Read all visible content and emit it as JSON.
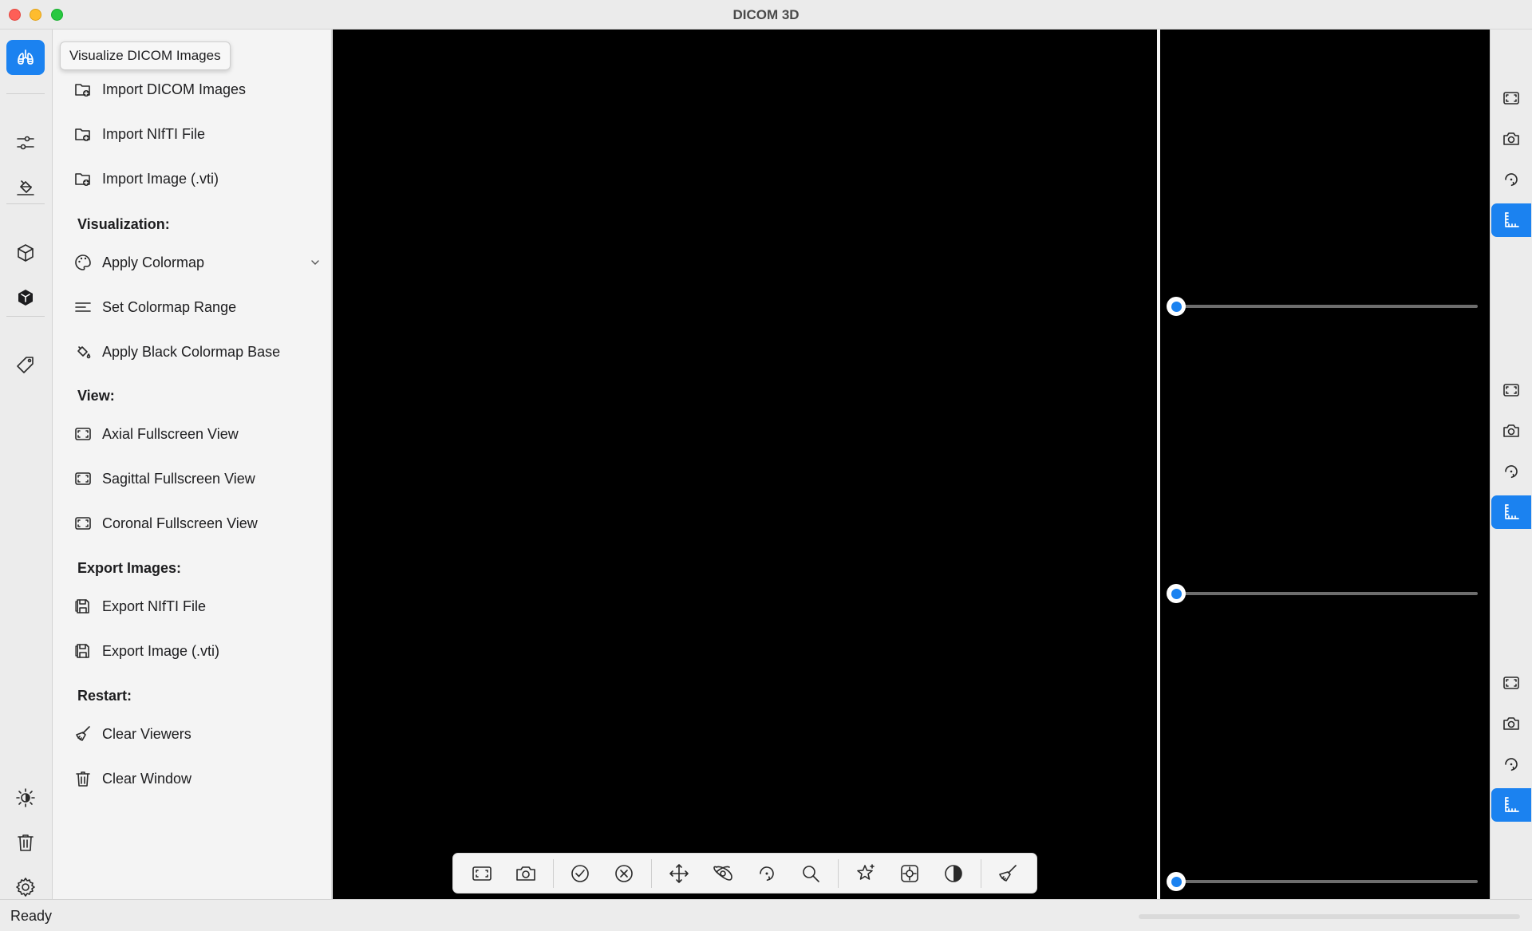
{
  "window": {
    "title": "DICOM 3D"
  },
  "tooltip": {
    "text": "Visualize DICOM Images"
  },
  "rail": {
    "items": [
      {
        "icon": "lungs-icon",
        "active": true
      },
      {
        "icon": "sliders-icon"
      },
      {
        "icon": "paint-bucket-icon"
      },
      {
        "icon": "cube-outline-icon"
      },
      {
        "icon": "cube-solid-icon"
      },
      {
        "icon": "tag-icon"
      },
      {
        "icon": "brightness-icon"
      },
      {
        "icon": "trash-icon"
      },
      {
        "icon": "gear-icon"
      }
    ]
  },
  "menu": {
    "import": [
      {
        "label": "Import DICOM Images",
        "icon": "folder-add-icon"
      },
      {
        "label": "Import NIfTI File",
        "icon": "folder-add-icon"
      },
      {
        "label": "Import Image (.vti)",
        "icon": "folder-add-icon"
      }
    ],
    "visualization_label": "Visualization:",
    "visualization": [
      {
        "label": "Apply Colormap",
        "icon": "palette-icon"
      },
      {
        "label": "Set Colormap Range",
        "icon": "lines-icon"
      },
      {
        "label": "Apply Black Colormap Base",
        "icon": "paint-bucket-icon"
      }
    ],
    "view_label": "View:",
    "view": [
      {
        "label": "Axial Fullscreen View",
        "icon": "fullscreen-icon"
      },
      {
        "label": "Sagittal Fullscreen View",
        "icon": "fullscreen-icon"
      },
      {
        "label": "Coronal Fullscreen View",
        "icon": "fullscreen-icon"
      }
    ],
    "export_label": "Export Images:",
    "export": [
      {
        "label": "Export NIfTI File",
        "icon": "save-icon"
      },
      {
        "label": "Export Image (.vti)",
        "icon": "save-icon"
      }
    ],
    "restart_label": "Restart:",
    "restart": [
      {
        "label": "Clear Viewers",
        "icon": "broom-icon"
      },
      {
        "label": "Clear Window",
        "icon": "trash-icon"
      }
    ]
  },
  "sliders": [
    {
      "value": 0
    },
    {
      "value": 0
    },
    {
      "value": 0
    }
  ],
  "status": {
    "text": "Ready"
  },
  "colors": {
    "accent": "#1b82f0",
    "viewer_bg": "#000000"
  }
}
